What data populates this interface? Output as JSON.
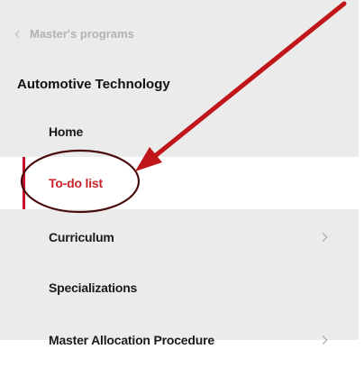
{
  "nav": {
    "back_label": "Master's programs",
    "section_title": "Automotive Technology",
    "items": [
      {
        "label": "Home",
        "active": false,
        "has_submenu": false
      },
      {
        "label": "To-do list",
        "active": true,
        "has_submenu": false
      },
      {
        "label": "Curriculum",
        "active": false,
        "has_submenu": true
      },
      {
        "label": "Specializations",
        "active": false,
        "has_submenu": false
      },
      {
        "label": "Master Allocation Procedure",
        "active": false,
        "has_submenu": true
      }
    ]
  },
  "colors": {
    "accent": "#c8102e",
    "annotation": "#c0161a",
    "panel_bg": "#ebebeb"
  }
}
